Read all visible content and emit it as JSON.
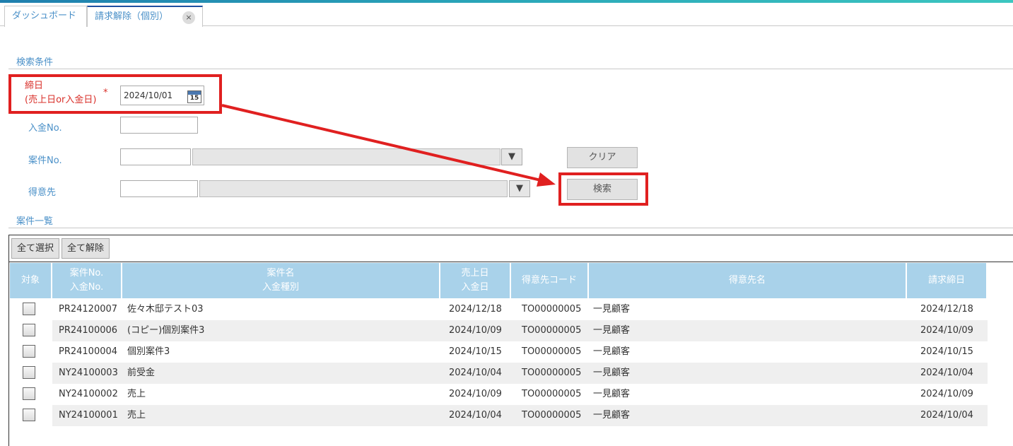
{
  "tabs": [
    {
      "label": "ダッシュボード"
    },
    {
      "label": "請求解除（個別）",
      "close": "×"
    }
  ],
  "search": {
    "section_title": "検索条件",
    "closing_date_label_line1": "締日",
    "closing_date_label_line2": "(売上日or入金日)",
    "required_mark": "*",
    "closing_date_value": "2024/10/01",
    "calendar_day": "15",
    "payment_no_label": "入金No.",
    "payment_no_value": "",
    "project_no_label": "案件No.",
    "project_no_value": "",
    "customer_label": "得意先",
    "customer_value": "",
    "clear_label": "クリア",
    "search_label": "検索",
    "dropdown_arrow": "▼"
  },
  "list": {
    "section_title": "案件一覧",
    "select_all_label": "全て選択",
    "deselect_all_label": "全て解除",
    "columns": [
      {
        "line1": "対象",
        "line2": ""
      },
      {
        "line1": "案件No.",
        "line2": "入金No."
      },
      {
        "line1": "案件名",
        "line2": "入金種別"
      },
      {
        "line1": "売上日",
        "line2": "入金日"
      },
      {
        "line1": "得意先コード",
        "line2": ""
      },
      {
        "line1": "得意先名",
        "line2": ""
      },
      {
        "line1": "請求締日",
        "line2": ""
      }
    ],
    "rows": [
      {
        "no": "PR24120007",
        "name": "佐々木邸テスト03",
        "date": "2024/12/18",
        "code": "TO00000005",
        "customer": "一見顧客",
        "closing": "2024/12/18"
      },
      {
        "no": "PR24100006",
        "name": "(コピー)個別案件3",
        "date": "2024/10/09",
        "code": "TO00000005",
        "customer": "一見顧客",
        "closing": "2024/10/09"
      },
      {
        "no": "PR24100004",
        "name": "個別案件3",
        "date": "2024/10/15",
        "code": "TO00000005",
        "customer": "一見顧客",
        "closing": "2024/10/15"
      },
      {
        "no": "NY24100003",
        "name": "前受金",
        "date": "2024/10/04",
        "code": "TO00000005",
        "customer": "一見顧客",
        "closing": "2024/10/04"
      },
      {
        "no": "NY24100002",
        "name": "売上",
        "date": "2024/10/09",
        "code": "TO00000005",
        "customer": "一見顧客",
        "closing": "2024/10/09"
      },
      {
        "no": "NY24100001",
        "name": "売上",
        "date": "2024/10/04",
        "code": "TO00000005",
        "customer": "一見顧客",
        "closing": "2024/10/04"
      }
    ]
  },
  "colors": {
    "accent": "#4a90c8",
    "header_bg": "#a9d2ea",
    "annotation_red": "#e02020",
    "required_red": "#d9302a"
  }
}
